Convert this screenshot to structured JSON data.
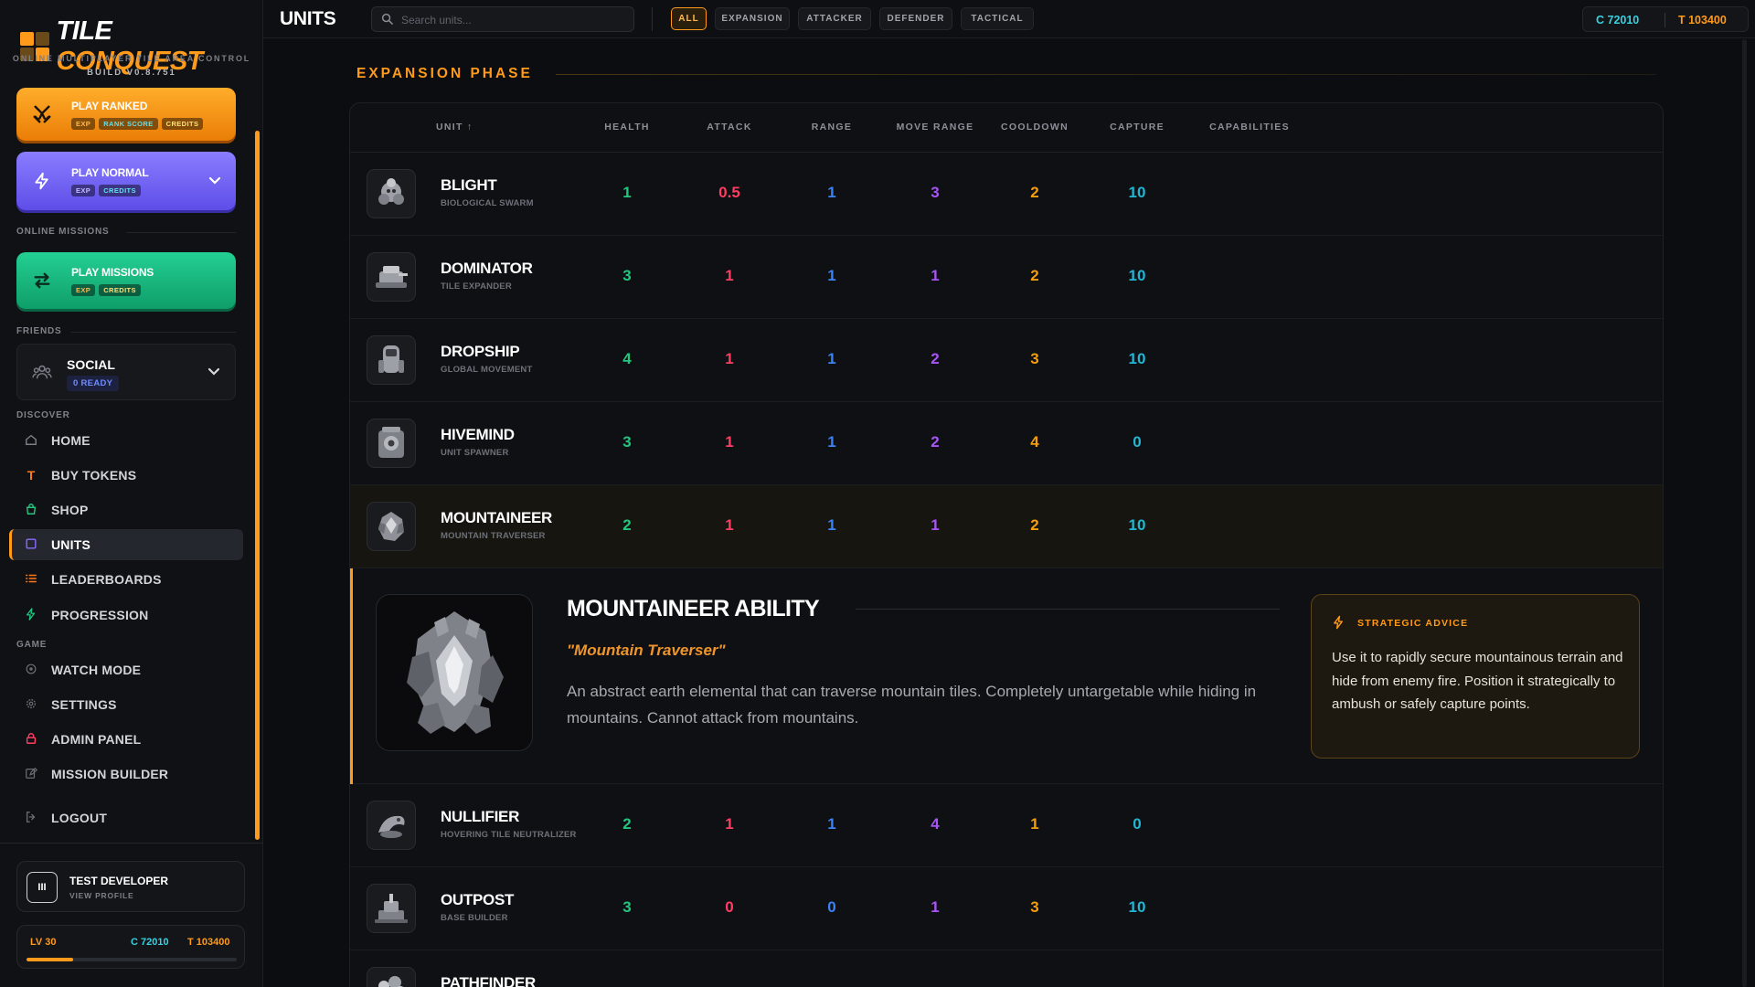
{
  "app": {
    "title_part1": "TILE",
    "title_part2": "CONQUEST",
    "subtitle": "ONLINE MULTIPLAYER TILE AREA CONTROL",
    "build": "BUILD V0.8.751"
  },
  "play": {
    "ranked": {
      "label": "PLAY RANKED",
      "tags": [
        "EXP",
        "RANK SCORE",
        "CREDITS"
      ]
    },
    "normal": {
      "label": "PLAY NORMAL",
      "tags": [
        "EXP",
        "CREDITS"
      ]
    },
    "missions": {
      "label": "PLAY MISSIONS",
      "tags": [
        "EXP",
        "CREDITS"
      ]
    }
  },
  "sections": {
    "online_missions": "ONLINE MISSIONS",
    "friends": "FRIENDS",
    "discover": "DISCOVER",
    "game": "GAME"
  },
  "social": {
    "label": "SOCIAL",
    "badge": "0 READY"
  },
  "nav": {
    "discover": [
      {
        "label": "HOME",
        "icon": "home-icon"
      },
      {
        "label": "BUY TOKENS",
        "icon": "token-icon"
      },
      {
        "label": "SHOP",
        "icon": "shop-bag-icon"
      },
      {
        "label": "UNITS",
        "icon": "units-icon",
        "active": true
      },
      {
        "label": "LEADERBOARDS",
        "icon": "list-icon"
      },
      {
        "label": "PROGRESSION",
        "icon": "bolt-icon"
      }
    ],
    "game": [
      {
        "label": "WATCH MODE",
        "icon": "eye-icon"
      },
      {
        "label": "SETTINGS",
        "icon": "gear-icon"
      },
      {
        "label": "ADMIN PANEL",
        "icon": "lock-icon"
      },
      {
        "label": "MISSION BUILDER",
        "icon": "edit-icon"
      }
    ],
    "logout": {
      "label": "LOGOUT",
      "icon": "logout-icon"
    }
  },
  "profile": {
    "name": "TEST DEVELOPER",
    "view_label": "VIEW PROFILE",
    "avatar_initials": "III",
    "level": "LV 30",
    "credits": "C 72010",
    "tokens": "T 103400",
    "level_progress": 0.22
  },
  "topbar": {
    "title": "UNITS",
    "search_placeholder": "Search units...",
    "filters": [
      "ALL",
      "EXPANSION",
      "ATTACKER",
      "DEFENDER",
      "TACTICAL"
    ],
    "active_filter": "ALL",
    "credits": "C 72010",
    "tokens": "T 103400"
  },
  "phase": {
    "title": "EXPANSION PHASE"
  },
  "table": {
    "headers": {
      "unit": "UNIT ↑",
      "health": "HEALTH",
      "attack": "ATTACK",
      "range": "RANGE",
      "move": "MOVE RANGE",
      "cooldown": "COOLDOWN",
      "capture": "CAPTURE",
      "capabilities": "CAPABILITIES"
    },
    "rows": [
      {
        "name": "BLIGHT",
        "sub": "BIOLOGICAL SWARM",
        "health": "1",
        "attack": "0.5",
        "range": "1",
        "move": "3",
        "cooldown": "2",
        "capture": "10"
      },
      {
        "name": "DOMINATOR",
        "sub": "TILE EXPANDER",
        "health": "3",
        "attack": "1",
        "range": "1",
        "move": "1",
        "cooldown": "2",
        "capture": "10"
      },
      {
        "name": "DROPSHIP",
        "sub": "GLOBAL MOVEMENT",
        "health": "4",
        "attack": "1",
        "range": "1",
        "move": "2",
        "cooldown": "3",
        "capture": "10"
      },
      {
        "name": "HIVEMIND",
        "sub": "UNIT SPAWNER",
        "health": "3",
        "attack": "1",
        "range": "1",
        "move": "2",
        "cooldown": "4",
        "capture": "0"
      },
      {
        "name": "MOUNTAINEER",
        "sub": "MOUNTAIN TRAVERSER",
        "health": "2",
        "attack": "1",
        "range": "1",
        "move": "1",
        "cooldown": "2",
        "capture": "10"
      },
      {
        "name": "NULLIFIER",
        "sub": "HOVERING TILE NEUTRALIZER",
        "health": "2",
        "attack": "1",
        "range": "1",
        "move": "4",
        "cooldown": "1",
        "capture": "0"
      },
      {
        "name": "OUTPOST",
        "sub": "BASE BUILDER",
        "health": "3",
        "attack": "0",
        "range": "0",
        "move": "1",
        "cooldown": "3",
        "capture": "10"
      },
      {
        "name": "PATHFINDER",
        "sub": "",
        "health": "",
        "attack": "",
        "range": "",
        "move": "",
        "cooldown": "",
        "capture": ""
      }
    ]
  },
  "ability": {
    "title": "MOUNTAINEER ABILITY",
    "quote": "\"Mountain Traverser\"",
    "description": "An abstract earth elemental that can traverse mountain tiles. Completely untargetable while hiding in mountains. Cannot attack from mountains.",
    "advice_title": "STRATEGIC ADVICE",
    "advice_text": "Use it to rapidly secure mountainous terrain and hide from enemy fire. Position it strategically to ambush or safely capture points."
  },
  "colors": {
    "accent": "#ff9a1a",
    "health": "#21c77f",
    "attack": "#ff3d63",
    "range": "#3b82f6",
    "move": "#a855f7",
    "cooldown": "#f59e0b",
    "capture": "#22b6d3"
  }
}
